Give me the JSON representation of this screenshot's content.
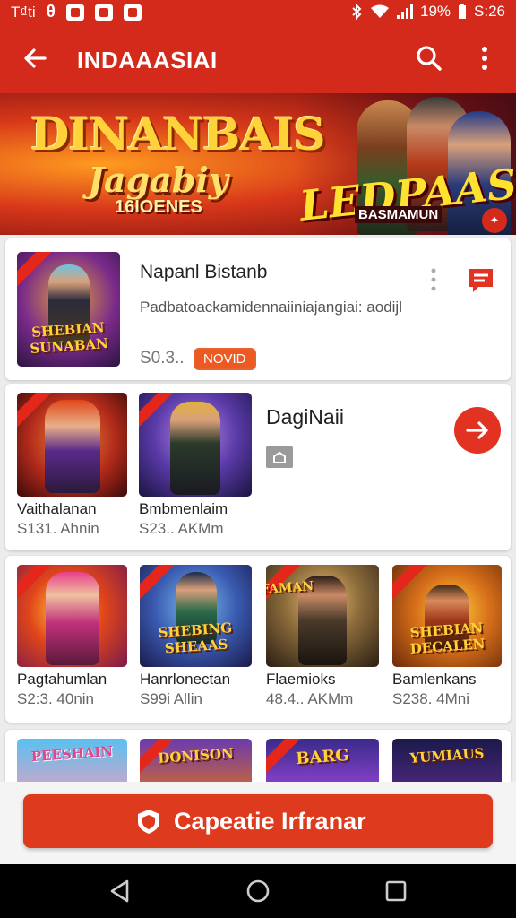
{
  "status_bar": {
    "left_text": "T₫ti",
    "left_glyph": "θ",
    "battery": "19%",
    "clock": "S:26"
  },
  "app_bar": {
    "title": "INDAAASIAI",
    "back_icon": "arrow-left-icon",
    "search_icon": "search-icon",
    "more_icon": "more-vert-icon"
  },
  "banner": {
    "title_line1": "DINANBAIS",
    "title_line2": "Jagabiy",
    "title_line3": "16IOENES",
    "logo": "LEDPAASH",
    "logo_sub": "BASMAMUN"
  },
  "featured": {
    "thumb_text": "SHEBIAN SUNABAN",
    "title": "Napanl Bistanb",
    "description": "Padbatoackamidennaiiniajangiai: aodijl",
    "price": "S0.3..",
    "badge": "NOVID",
    "colors": {
      "accent": "#d42a1c",
      "badge": "#ec5a22"
    }
  },
  "row_card": {
    "tiles": [
      {
        "name": "Vaithalanan",
        "meta": "S131.  Ahnin"
      },
      {
        "name": "Bmbmenlaim",
        "meta": "S23..  AKMm"
      }
    ],
    "title": "DagiNaii",
    "icon": "store-icon",
    "arrow_icon": "arrow-right-icon"
  },
  "grid": {
    "tiles": [
      {
        "name": "Pagtahumlan",
        "meta": "S2:3.  40nin",
        "thumb_text": ""
      },
      {
        "name": "Hanrlonectan",
        "meta": "S99i  Allin",
        "thumb_text": "SHEBING SHEAAS"
      },
      {
        "name": "Flaemioks",
        "meta": "48.4..  AKMm",
        "thumb_text": "FAMAN"
      },
      {
        "name": "Bamlenkans",
        "meta": "S238.  4Mni",
        "thumb_text": "SHEBIAN DECALEN"
      }
    ]
  },
  "bottom_row": {
    "thumbs": [
      "PEESHAIN",
      "DONISON",
      "BARG",
      "YUMIAUS"
    ]
  },
  "cta": {
    "label": "Capeatie Irfranar",
    "icon": "shield-icon"
  },
  "nav": {
    "back": "nav-back-icon",
    "home": "nav-home-icon",
    "recents": "nav-recents-icon"
  }
}
